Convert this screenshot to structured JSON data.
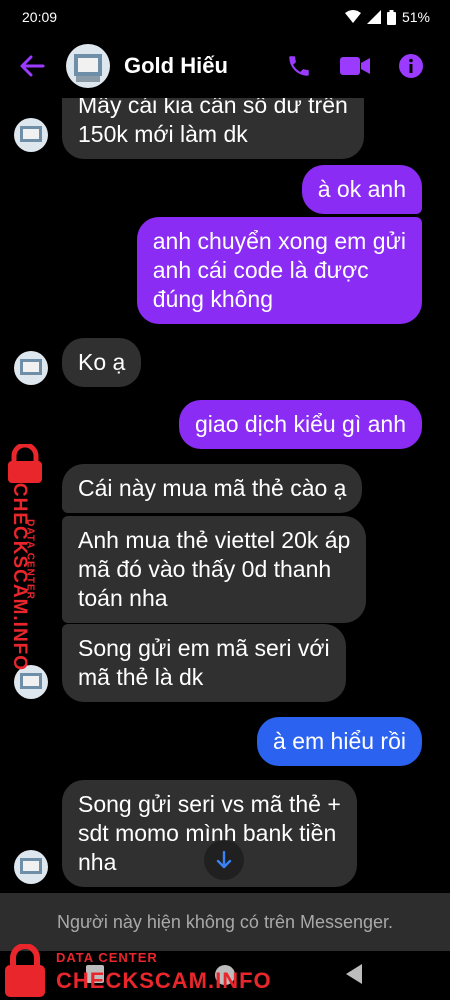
{
  "status_bar": {
    "time": "20:09",
    "battery": "51%"
  },
  "header": {
    "contact_name": "Gold Hiếu",
    "icons": [
      "back-arrow-icon",
      "phone-icon",
      "video-camera-icon",
      "info-icon"
    ]
  },
  "messages": [
    {
      "direction": "incoming",
      "text_lines": [
        "Mấy cái kia cần số dư trên",
        "150k mới làm dk"
      ]
    },
    {
      "direction": "outgoing",
      "text_lines": [
        "à ok anh"
      ]
    },
    {
      "direction": "outgoing",
      "text_lines": [
        "anh chuyển xong em gửi",
        "anh cái code là được",
        "đúng không"
      ]
    },
    {
      "direction": "incoming",
      "text_lines": [
        "Ko ạ"
      ]
    },
    {
      "direction": "outgoing",
      "text_lines": [
        "giao dịch kiểu gì anh"
      ]
    },
    {
      "direction": "incoming",
      "text_lines": [
        "Cái này mua mã thẻ cào ạ"
      ]
    },
    {
      "direction": "incoming",
      "text_lines": [
        "Anh mua thẻ viettel 20k áp",
        "mã đó vào thấy 0d thanh",
        "toán nha"
      ]
    },
    {
      "direction": "incoming",
      "text_lines": [
        "Song gửi em mã seri với",
        "mã thẻ là dk"
      ]
    },
    {
      "direction": "outgoing",
      "text_lines": [
        "à em hiểu rồi"
      ]
    },
    {
      "direction": "incoming",
      "text_lines": [
        "Song gửi seri vs mã thẻ +",
        "sdt momo mình bank tiền",
        "nha"
      ]
    }
  ],
  "footer": {
    "unavailable_notice": "Người này hiện không có trên Messenger."
  },
  "watermark": {
    "sub": "DATA CENTER",
    "main": "CHECKSCAM.INFO"
  },
  "colors": {
    "accent_purple": "#8b2cf5",
    "bubble_blue": "#2b63f0",
    "incoming_bubble": "#303030",
    "watermark_red": "#e8262c"
  }
}
